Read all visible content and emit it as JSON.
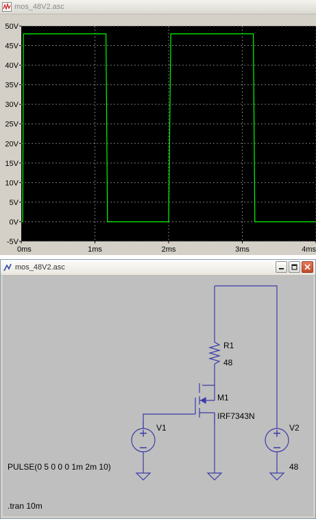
{
  "plot_window": {
    "title": "mos_48V2.asc",
    "icon": "waveform-icon"
  },
  "schematic_window": {
    "title": "mos_48V2.asc",
    "icon": "schematic-icon",
    "buttons": [
      "minimize",
      "maximize",
      "close"
    ]
  },
  "chart_data": {
    "type": "line",
    "x_unit": "ms",
    "y_unit": "V",
    "xlim": [
      0,
      4
    ],
    "ylim": [
      -5,
      50
    ],
    "x_ticks": [
      "0ms",
      "1ms",
      "2ms",
      "3ms",
      "4ms"
    ],
    "y_ticks": [
      "-5V",
      "0V",
      "5V",
      "10V",
      "15V",
      "20V",
      "25V",
      "30V",
      "35V",
      "40V",
      "45V",
      "50V"
    ],
    "grid": true,
    "background": "#000000",
    "series": [
      {
        "color": "#00ff00",
        "x": [
          0,
          0.02,
          0.03,
          0.05,
          1.15,
          1.17,
          2.0,
          2.03,
          2.05,
          3.15,
          3.17,
          4.0
        ],
        "y": [
          0,
          0,
          48,
          48,
          48,
          0,
          0,
          48,
          48,
          48,
          0,
          0
        ]
      }
    ]
  },
  "schematic": {
    "wire_color": "#3a3aa8",
    "components": {
      "R1": {
        "name": "R1",
        "value": "48"
      },
      "M1": {
        "name": "M1",
        "value": "IRF7343N"
      },
      "V1": {
        "name": "V1",
        "value": "PULSE(0 5 0 0 0 1m 2m 10)"
      },
      "V2": {
        "name": "V2",
        "value": "48"
      }
    },
    "directive": ".tran 10m"
  }
}
